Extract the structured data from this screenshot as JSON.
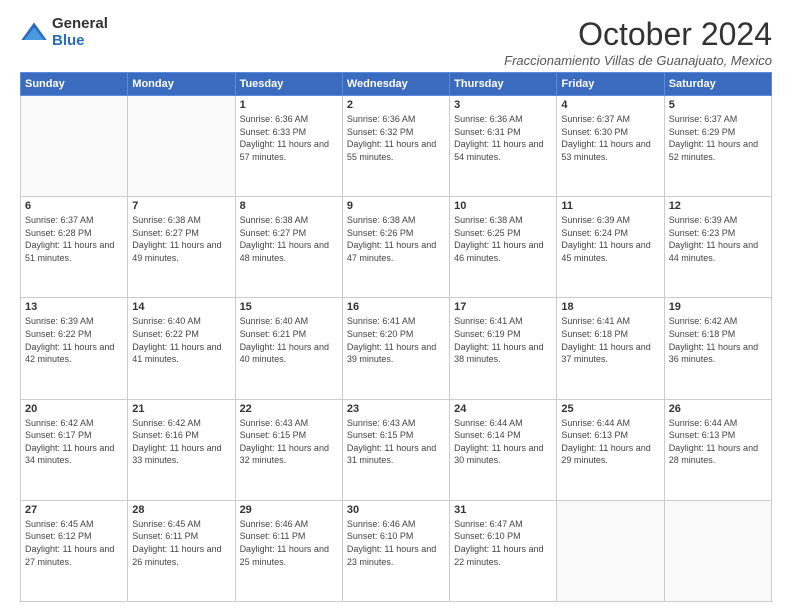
{
  "logo": {
    "general": "General",
    "blue": "Blue"
  },
  "title": "October 2024",
  "location": "Fraccionamiento Villas de Guanajuato, Mexico",
  "days_of_week": [
    "Sunday",
    "Monday",
    "Tuesday",
    "Wednesday",
    "Thursday",
    "Friday",
    "Saturday"
  ],
  "weeks": [
    [
      {
        "day": "",
        "info": ""
      },
      {
        "day": "",
        "info": ""
      },
      {
        "day": "1",
        "info": "Sunrise: 6:36 AM\nSunset: 6:33 PM\nDaylight: 11 hours and 57 minutes."
      },
      {
        "day": "2",
        "info": "Sunrise: 6:36 AM\nSunset: 6:32 PM\nDaylight: 11 hours and 55 minutes."
      },
      {
        "day": "3",
        "info": "Sunrise: 6:36 AM\nSunset: 6:31 PM\nDaylight: 11 hours and 54 minutes."
      },
      {
        "day": "4",
        "info": "Sunrise: 6:37 AM\nSunset: 6:30 PM\nDaylight: 11 hours and 53 minutes."
      },
      {
        "day": "5",
        "info": "Sunrise: 6:37 AM\nSunset: 6:29 PM\nDaylight: 11 hours and 52 minutes."
      }
    ],
    [
      {
        "day": "6",
        "info": "Sunrise: 6:37 AM\nSunset: 6:28 PM\nDaylight: 11 hours and 51 minutes."
      },
      {
        "day": "7",
        "info": "Sunrise: 6:38 AM\nSunset: 6:27 PM\nDaylight: 11 hours and 49 minutes."
      },
      {
        "day": "8",
        "info": "Sunrise: 6:38 AM\nSunset: 6:27 PM\nDaylight: 11 hours and 48 minutes."
      },
      {
        "day": "9",
        "info": "Sunrise: 6:38 AM\nSunset: 6:26 PM\nDaylight: 11 hours and 47 minutes."
      },
      {
        "day": "10",
        "info": "Sunrise: 6:38 AM\nSunset: 6:25 PM\nDaylight: 11 hours and 46 minutes."
      },
      {
        "day": "11",
        "info": "Sunrise: 6:39 AM\nSunset: 6:24 PM\nDaylight: 11 hours and 45 minutes."
      },
      {
        "day": "12",
        "info": "Sunrise: 6:39 AM\nSunset: 6:23 PM\nDaylight: 11 hours and 44 minutes."
      }
    ],
    [
      {
        "day": "13",
        "info": "Sunrise: 6:39 AM\nSunset: 6:22 PM\nDaylight: 11 hours and 42 minutes."
      },
      {
        "day": "14",
        "info": "Sunrise: 6:40 AM\nSunset: 6:22 PM\nDaylight: 11 hours and 41 minutes."
      },
      {
        "day": "15",
        "info": "Sunrise: 6:40 AM\nSunset: 6:21 PM\nDaylight: 11 hours and 40 minutes."
      },
      {
        "day": "16",
        "info": "Sunrise: 6:41 AM\nSunset: 6:20 PM\nDaylight: 11 hours and 39 minutes."
      },
      {
        "day": "17",
        "info": "Sunrise: 6:41 AM\nSunset: 6:19 PM\nDaylight: 11 hours and 38 minutes."
      },
      {
        "day": "18",
        "info": "Sunrise: 6:41 AM\nSunset: 6:18 PM\nDaylight: 11 hours and 37 minutes."
      },
      {
        "day": "19",
        "info": "Sunrise: 6:42 AM\nSunset: 6:18 PM\nDaylight: 11 hours and 36 minutes."
      }
    ],
    [
      {
        "day": "20",
        "info": "Sunrise: 6:42 AM\nSunset: 6:17 PM\nDaylight: 11 hours and 34 minutes."
      },
      {
        "day": "21",
        "info": "Sunrise: 6:42 AM\nSunset: 6:16 PM\nDaylight: 11 hours and 33 minutes."
      },
      {
        "day": "22",
        "info": "Sunrise: 6:43 AM\nSunset: 6:15 PM\nDaylight: 11 hours and 32 minutes."
      },
      {
        "day": "23",
        "info": "Sunrise: 6:43 AM\nSunset: 6:15 PM\nDaylight: 11 hours and 31 minutes."
      },
      {
        "day": "24",
        "info": "Sunrise: 6:44 AM\nSunset: 6:14 PM\nDaylight: 11 hours and 30 minutes."
      },
      {
        "day": "25",
        "info": "Sunrise: 6:44 AM\nSunset: 6:13 PM\nDaylight: 11 hours and 29 minutes."
      },
      {
        "day": "26",
        "info": "Sunrise: 6:44 AM\nSunset: 6:13 PM\nDaylight: 11 hours and 28 minutes."
      }
    ],
    [
      {
        "day": "27",
        "info": "Sunrise: 6:45 AM\nSunset: 6:12 PM\nDaylight: 11 hours and 27 minutes."
      },
      {
        "day": "28",
        "info": "Sunrise: 6:45 AM\nSunset: 6:11 PM\nDaylight: 11 hours and 26 minutes."
      },
      {
        "day": "29",
        "info": "Sunrise: 6:46 AM\nSunset: 6:11 PM\nDaylight: 11 hours and 25 minutes."
      },
      {
        "day": "30",
        "info": "Sunrise: 6:46 AM\nSunset: 6:10 PM\nDaylight: 11 hours and 23 minutes."
      },
      {
        "day": "31",
        "info": "Sunrise: 6:47 AM\nSunset: 6:10 PM\nDaylight: 11 hours and 22 minutes."
      },
      {
        "day": "",
        "info": ""
      },
      {
        "day": "",
        "info": ""
      }
    ]
  ]
}
